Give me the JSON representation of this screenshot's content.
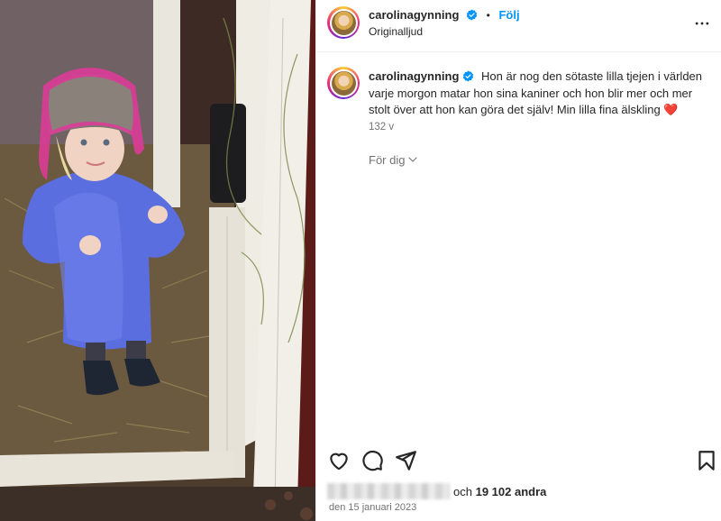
{
  "post": {
    "username": "carolinagynning",
    "follow_label": "Följ",
    "audio_label": "Originalljud",
    "caption": "Hon är nog den sötaste lilla tjejen i världen varje morgon matar hon sina kaniner och hon blir mer och mer stolt över att hon kan göra det själv! Min lilla fina älskling ❤️",
    "caption_age": "132 v",
    "for_you_label": "För dig",
    "likes_prefix": "och",
    "likes_count": "19 102 andra",
    "date": "den 15 januari 2023"
  },
  "icons": {
    "verified": "verified-badge-icon",
    "more": "more-options-icon",
    "like": "heart-icon",
    "comment": "comment-icon",
    "share": "send-icon",
    "save": "bookmark-icon",
    "chevron": "chevron-down-icon"
  },
  "colors": {
    "accent": "#0095f6",
    "text": "#262626",
    "muted": "#737373",
    "verified": "#0095f6"
  }
}
